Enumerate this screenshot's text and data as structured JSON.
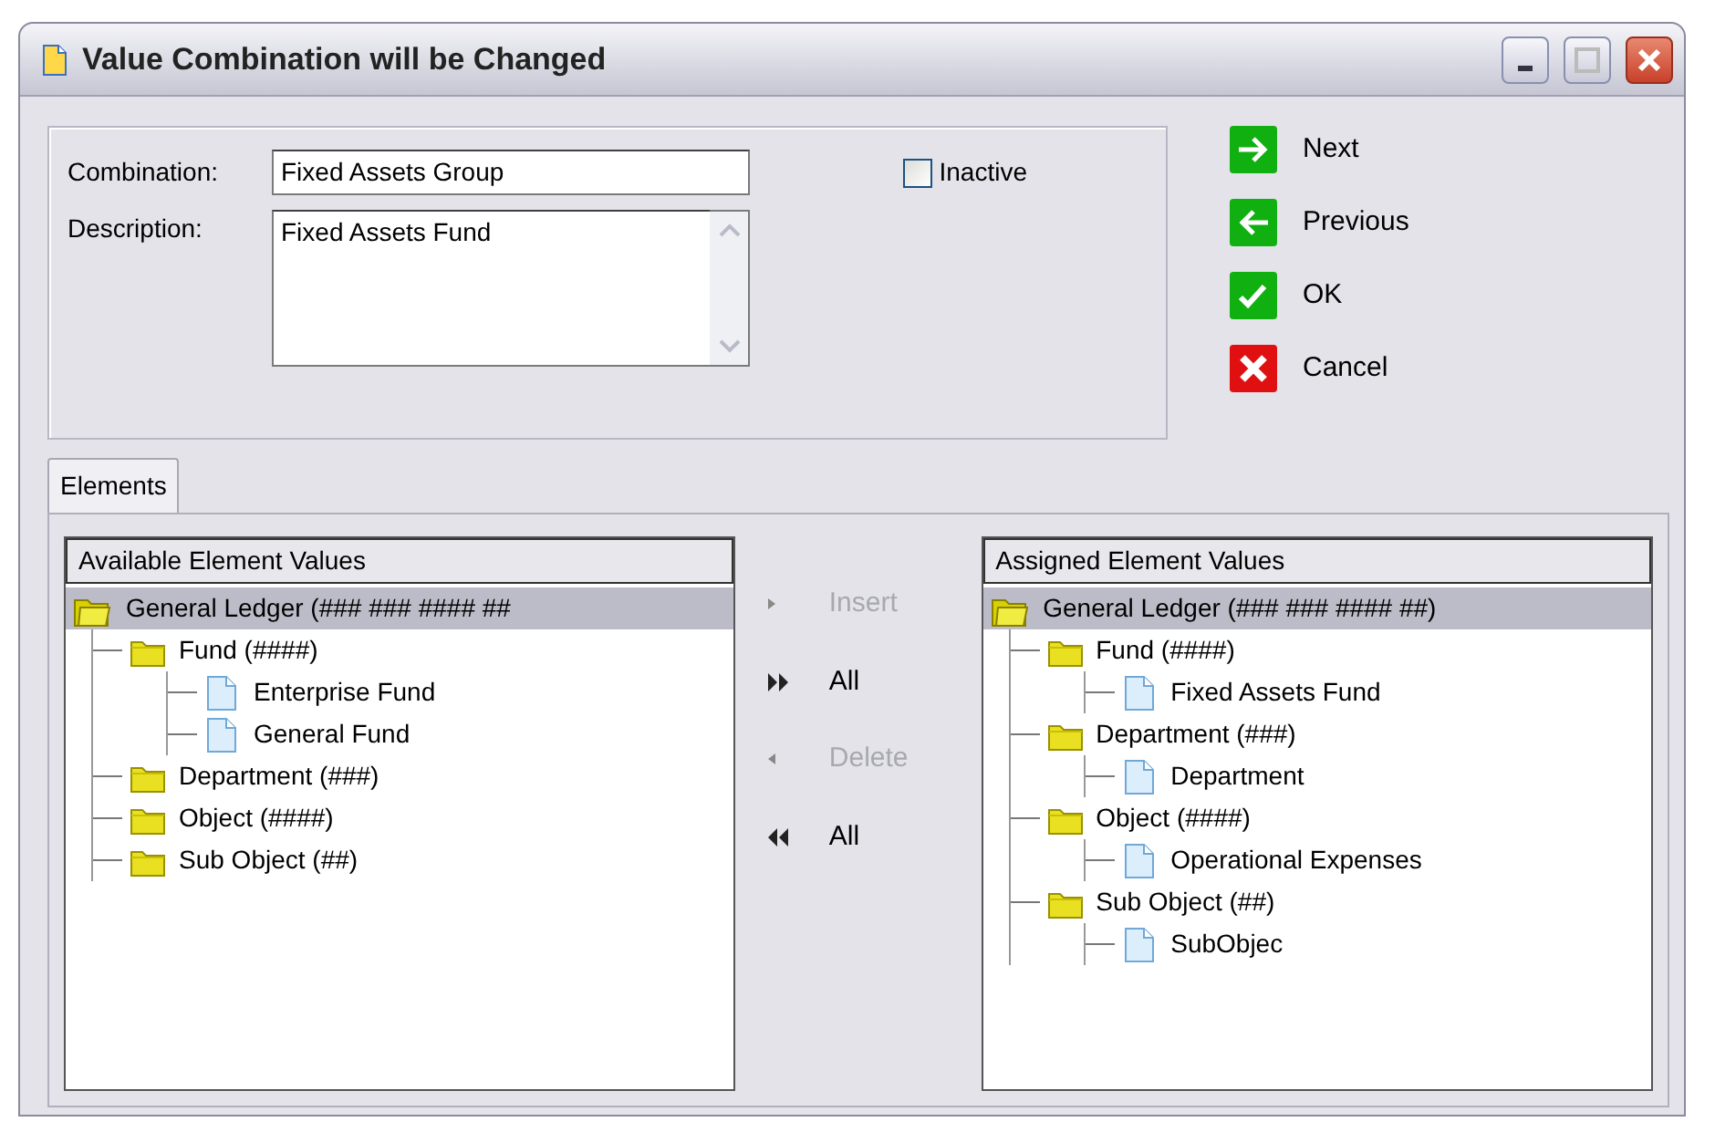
{
  "window": {
    "title": "Value Combination will be Changed"
  },
  "form": {
    "combination_label": "Combination:",
    "combination_value": "Fixed Assets Group",
    "description_label": "Description:",
    "description_value": "Fixed Assets Fund",
    "inactive": {
      "label": "Inactive",
      "checked": false
    }
  },
  "actions": [
    {
      "label": "Next",
      "kind": "next"
    },
    {
      "label": "Previous",
      "kind": "previous"
    },
    {
      "label": "OK",
      "kind": "ok"
    },
    {
      "label": "Cancel",
      "kind": "cancel"
    }
  ],
  "tabs": [
    {
      "label": "Elements",
      "selected": true
    }
  ],
  "available": {
    "header": "Available Element Values",
    "tree": [
      {
        "label": "General Ledger (### ### #### ##",
        "kind": "root",
        "selected": true,
        "children": [
          {
            "label": "Fund (####)",
            "kind": "folder",
            "selected": false,
            "children": [
              {
                "label": "Enterprise Fund",
                "kind": "doc",
                "selected": false
              },
              {
                "label": "General Fund",
                "kind": "doc",
                "selected": false
              }
            ]
          },
          {
            "label": "Department (###)",
            "kind": "folder",
            "selected": false
          },
          {
            "label": "Object (####)",
            "kind": "folder",
            "selected": false
          },
          {
            "label": "Sub Object (##)",
            "kind": "folder",
            "selected": false
          }
        ]
      }
    ]
  },
  "transfer": [
    {
      "label": "Insert",
      "kind": "one-right",
      "disabled": true
    },
    {
      "label": "All",
      "kind": "all-right",
      "disabled": false
    },
    {
      "label": "Delete",
      "kind": "one-left",
      "disabled": true
    },
    {
      "label": "All",
      "kind": "all-left",
      "disabled": false
    }
  ],
  "assigned": {
    "header": "Assigned Element Values",
    "tree": [
      {
        "label": "General Ledger (### ### #### ##)",
        "kind": "root",
        "selected": true,
        "children": [
          {
            "label": "Fund (####)",
            "kind": "folder",
            "selected": false,
            "children": [
              {
                "label": "Fixed Assets Fund",
                "kind": "doc",
                "selected": false
              }
            ]
          },
          {
            "label": "Department (###)",
            "kind": "folder",
            "selected": false,
            "children": [
              {
                "label": "Department",
                "kind": "doc",
                "selected": false
              }
            ]
          },
          {
            "label": "Object (####)",
            "kind": "folder",
            "selected": false,
            "children": [
              {
                "label": "Operational Expenses",
                "kind": "doc",
                "selected": false
              }
            ]
          },
          {
            "label": "Sub Object (##)",
            "kind": "folder",
            "selected": false,
            "children": [
              {
                "label": "SubObjec",
                "kind": "doc",
                "selected": false
              }
            ]
          }
        ]
      }
    ]
  }
}
